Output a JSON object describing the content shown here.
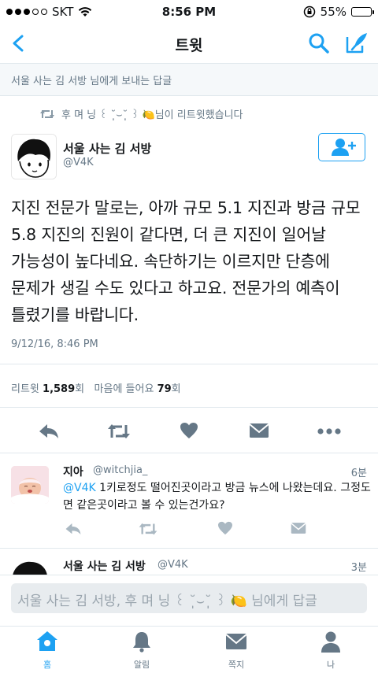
{
  "status_bar": {
    "carrier": "SKT",
    "time": "8:56 PM",
    "battery_text": "55%",
    "battery_level": 0.55,
    "battery_color": "#f5c518"
  },
  "nav": {
    "title": "트윗",
    "back_icon": "chevron-left-icon",
    "search_icon": "search-icon",
    "compose_icon": "compose-icon",
    "accent": "#1da1f2"
  },
  "reply_context": "서울 사는 김 서방 님에게 보내는 답글",
  "retweet_context": "후 며 닝 ꒰ ˘̩̩̩⌣˘̩̩̩ ꒱ 🍋님이 리트윗했습니다",
  "tweet": {
    "author_name": "서울 사는 김 서방",
    "author_handle": "@V4K",
    "text": "지진 전문가 말로는, 아까 규모 5.1 지진과 방금 규모 5.8 지진의 진원이 같다면, 더 큰 지진이 일어날 가능성이 높다네요. 속단하기는 이르지만 단층에 문제가 생길 수도 있다고 하고요. 전문가의 예측이 틀렸기를 바랍니다.",
    "timestamp": "9/12/16, 8:46 PM",
    "retweets_label": "리트윗",
    "retweets_count": "1,589",
    "count_suffix": "회",
    "likes_label": "마음에 들어요",
    "likes_count": "79"
  },
  "replies": [
    {
      "name": "지아",
      "handle": "@witchjia_",
      "time": "6분",
      "mention": "@V4K",
      "text": " 1키로정도 떨어진곳이라고 방금 뉴스에 나왔는데요. 그정도면 같은곳이라고 볼 수 있는건가요?"
    },
    {
      "name": "서울 사는 김 서방",
      "handle": "@V4K",
      "time": "3분"
    }
  ],
  "composer": {
    "placeholder": "서울 사는 김 서방, 후 며 닝 ꒰ ˘̩̩̩⌣˘̩̩̩ ꒱ 🍋 님에게 답글"
  },
  "tabs": [
    {
      "label": "홈",
      "icon": "home-icon",
      "active": true
    },
    {
      "label": "알림",
      "icon": "bell-icon",
      "active": false
    },
    {
      "label": "쪽지",
      "icon": "envelope-icon",
      "active": false
    },
    {
      "label": "나",
      "icon": "person-icon",
      "active": false
    }
  ]
}
